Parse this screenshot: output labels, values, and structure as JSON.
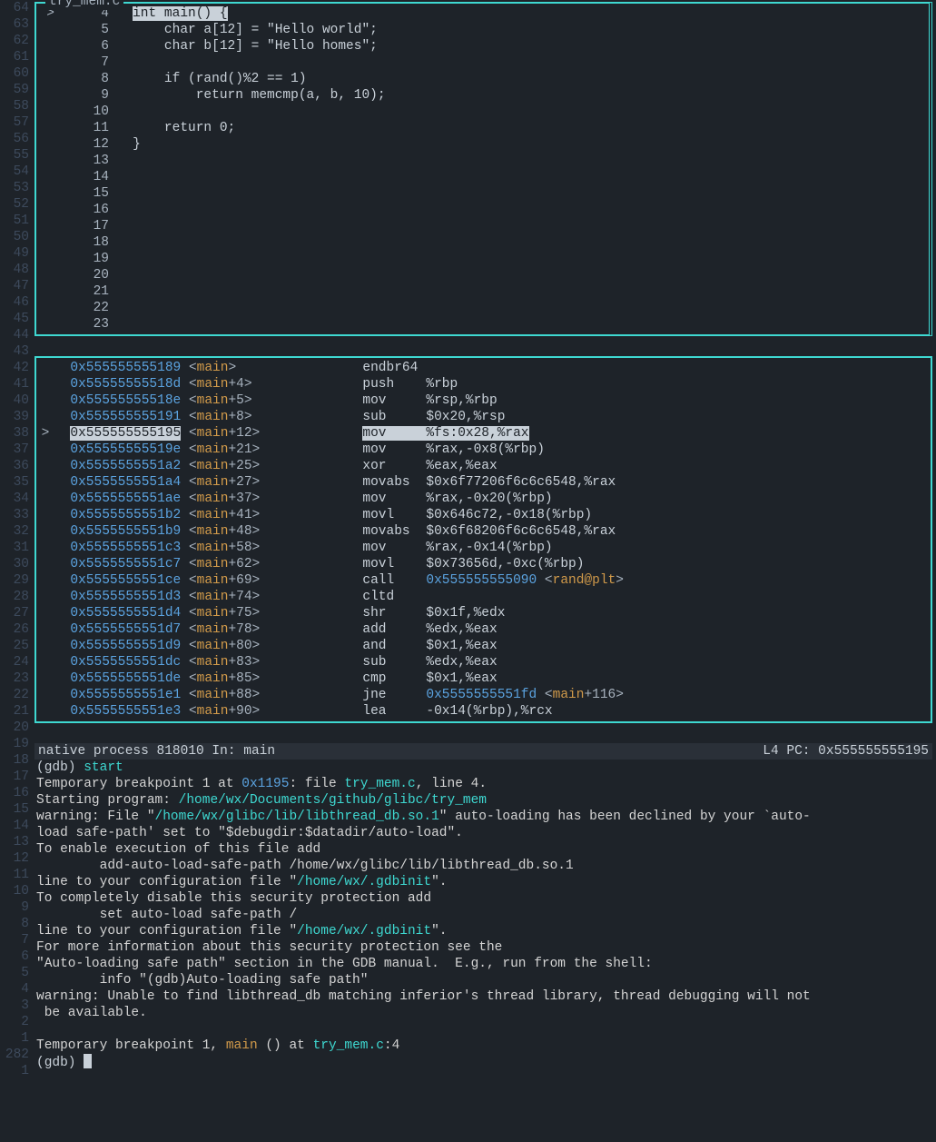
{
  "gutter": [
    "64",
    "63",
    "62",
    "61",
    "60",
    "59",
    "58",
    "57",
    "56",
    "55",
    "54",
    "53",
    "52",
    "51",
    "50",
    "49",
    "48",
    "47",
    "46",
    "45",
    "44",
    "43",
    "42",
    "41",
    "40",
    "39",
    "38",
    "37",
    "36",
    "35",
    "34",
    "33",
    "32",
    "31",
    "30",
    "29",
    "28",
    "27",
    "26",
    "25",
    "24",
    "23",
    "22",
    "21",
    "20",
    "19",
    "18",
    "17",
    "16",
    "15",
    "14",
    "13",
    "12",
    "11",
    "10",
    "9",
    "8",
    "7",
    "6",
    "5",
    "4",
    "3",
    "2",
    "1",
    "282",
    "1"
  ],
  "source": {
    "title": "try_mem.c",
    "lines": [
      {
        "arrow": ">",
        "n": "4",
        "sel": "int main() {",
        "rest": ""
      },
      {
        "arrow": " ",
        "n": "5",
        "code": "    char a[12] = \"Hello world\";"
      },
      {
        "arrow": " ",
        "n": "6",
        "code": "    char b[12] = \"Hello homes\";"
      },
      {
        "arrow": " ",
        "n": "7",
        "code": ""
      },
      {
        "arrow": " ",
        "n": "8",
        "code": "    if (rand()%2 == 1)"
      },
      {
        "arrow": " ",
        "n": "9",
        "code": "        return memcmp(a, b, 10);"
      },
      {
        "arrow": " ",
        "n": "10",
        "code": ""
      },
      {
        "arrow": " ",
        "n": "11",
        "code": "    return 0;"
      },
      {
        "arrow": " ",
        "n": "12",
        "code": "}"
      },
      {
        "arrow": " ",
        "n": "13",
        "code": ""
      },
      {
        "arrow": " ",
        "n": "14",
        "code": ""
      },
      {
        "arrow": " ",
        "n": "15",
        "code": ""
      },
      {
        "arrow": " ",
        "n": "16",
        "code": ""
      },
      {
        "arrow": " ",
        "n": "17",
        "code": ""
      },
      {
        "arrow": " ",
        "n": "18",
        "code": ""
      },
      {
        "arrow": " ",
        "n": "19",
        "code": ""
      },
      {
        "arrow": " ",
        "n": "20",
        "code": ""
      },
      {
        "arrow": " ",
        "n": "21",
        "code": ""
      },
      {
        "arrow": " ",
        "n": "22",
        "code": ""
      },
      {
        "arrow": " ",
        "n": "23",
        "code": ""
      }
    ]
  },
  "asm": {
    "lines": [
      {
        "a": "0x555555555189",
        "s": "main",
        "o": "",
        "m": "endbr64",
        "p": ""
      },
      {
        "a": "0x55555555518d",
        "s": "main",
        "o": "+4",
        "m": "push   ",
        "p": "%rbp"
      },
      {
        "a": "0x55555555518e",
        "s": "main",
        "o": "+5",
        "m": "mov    ",
        "p": "%rsp,%rbp"
      },
      {
        "a": "0x555555555191",
        "s": "main",
        "o": "+8",
        "m": "sub    ",
        "p": "$0x20,%rsp"
      },
      {
        "a": "0x555555555195",
        "s": "main",
        "o": "+12",
        "m": "mov    ",
        "p": "%fs:0x28,%rax",
        "hl": true,
        "arrow": ">"
      },
      {
        "a": "0x55555555519e",
        "s": "main",
        "o": "+21",
        "m": "mov    ",
        "p": "%rax,-0x8(%rbp)"
      },
      {
        "a": "0x5555555551a2",
        "s": "main",
        "o": "+25",
        "m": "xor    ",
        "p": "%eax,%eax"
      },
      {
        "a": "0x5555555551a4",
        "s": "main",
        "o": "+27",
        "m": "movabs ",
        "p": "$0x6f77206f6c6c6548,%rax"
      },
      {
        "a": "0x5555555551ae",
        "s": "main",
        "o": "+37",
        "m": "mov    ",
        "p": "%rax,-0x20(%rbp)"
      },
      {
        "a": "0x5555555551b2",
        "s": "main",
        "o": "+41",
        "m": "movl   ",
        "p": "$0x646c72,-0x18(%rbp)"
      },
      {
        "a": "0x5555555551b9",
        "s": "main",
        "o": "+48",
        "m": "movabs ",
        "p": "$0x6f68206f6c6c6548,%rax"
      },
      {
        "a": "0x5555555551c3",
        "s": "main",
        "o": "+58",
        "m": "mov    ",
        "p": "%rax,-0x14(%rbp)"
      },
      {
        "a": "0x5555555551c7",
        "s": "main",
        "o": "+62",
        "m": "movl   ",
        "p": "$0x73656d,-0xc(%rbp)"
      },
      {
        "a": "0x5555555551ce",
        "s": "main",
        "o": "+69",
        "m": "call   ",
        "t": "0x555555555090",
        "ts": "rand@plt"
      },
      {
        "a": "0x5555555551d3",
        "s": "main",
        "o": "+74",
        "m": "cltd   ",
        "p": ""
      },
      {
        "a": "0x5555555551d4",
        "s": "main",
        "o": "+75",
        "m": "shr    ",
        "p": "$0x1f,%edx"
      },
      {
        "a": "0x5555555551d7",
        "s": "main",
        "o": "+78",
        "m": "add    ",
        "p": "%edx,%eax"
      },
      {
        "a": "0x5555555551d9",
        "s": "main",
        "o": "+80",
        "m": "and    ",
        "p": "$0x1,%eax"
      },
      {
        "a": "0x5555555551dc",
        "s": "main",
        "o": "+83",
        "m": "sub    ",
        "p": "%edx,%eax"
      },
      {
        "a": "0x5555555551de",
        "s": "main",
        "o": "+85",
        "m": "cmp    ",
        "p": "$0x1,%eax"
      },
      {
        "a": "0x5555555551e1",
        "s": "main",
        "o": "+88",
        "m": "jne    ",
        "t": "0x5555555551fd",
        "ts": "main",
        "to": "+116"
      },
      {
        "a": "0x5555555551e3",
        "s": "main",
        "o": "+90",
        "m": "lea    ",
        "p": "-0x14(%rbp),%rcx"
      }
    ]
  },
  "status": {
    "left": "native process 818010 In: main",
    "right": "L4    PC: 0x555555555195 "
  },
  "log": {
    "l1_a": "(gdb) ",
    "l1_b": "start",
    "l2_a": "Temporary breakpoint 1 at ",
    "l2_b": "0x1195",
    "l2_c": ": file ",
    "l2_d": "try_mem.c",
    "l2_e": ", line 4.",
    "l3_a": "Starting program: ",
    "l3_b": "/home/wx/Documents/github/glibc/try_mem",
    "l4_a": "warning: File \"",
    "l4_b": "/home/wx/glibc/lib/libthread_db.so.1",
    "l4_c": "\" auto-loading has been declined by your `auto-",
    "l5": "load safe-path' set to \"$debugdir:$datadir/auto-load\".",
    "l6": "To enable execution of this file add",
    "l7": "        add-auto-load-safe-path /home/wx/glibc/lib/libthread_db.so.1",
    "l8_a": "line to your configuration file \"",
    "l8_b": "/home/wx/.gdbinit",
    "l8_c": "\".",
    "l9": "To completely disable this security protection add",
    "l10": "        set auto-load safe-path /",
    "l11_a": "line to your configuration file \"",
    "l11_b": "/home/wx/.gdbinit",
    "l11_c": "\".",
    "l12": "For more information about this security protection see the",
    "l13": "\"Auto-loading safe path\" section in the GDB manual.  E.g., run from the shell:",
    "l14": "        info \"(gdb)Auto-loading safe path\"",
    "l15": "warning: Unable to find libthread_db matching inferior's thread library, thread debugging will not",
    "l16": " be available.",
    "l17": "",
    "l18_a": "Temporary breakpoint 1, ",
    "l18_b": "main",
    "l18_c": " () at ",
    "l18_d": "try_mem.c",
    "l18_e": ":4",
    "l19": "(gdb) "
  }
}
